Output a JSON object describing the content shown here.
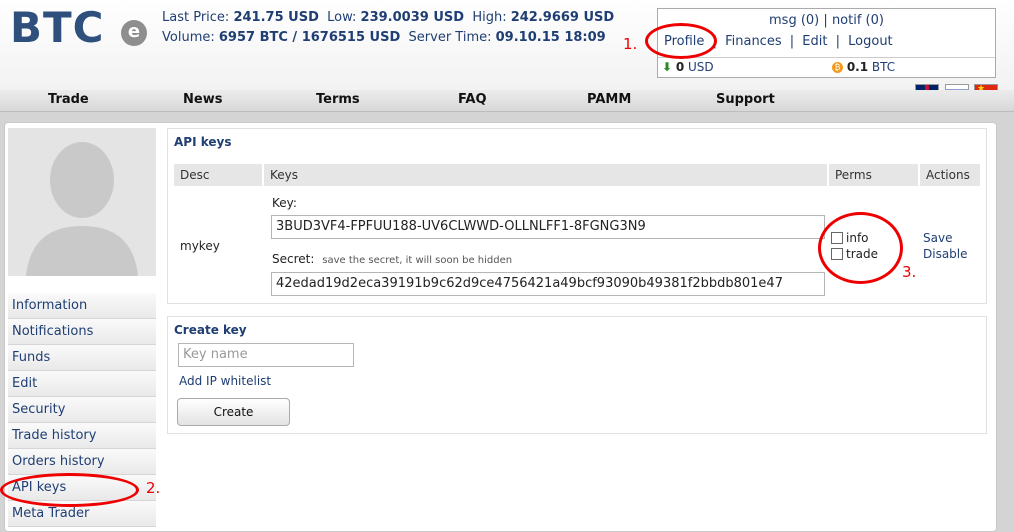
{
  "header": {
    "logo_text": "BTC",
    "logo_badge": "e",
    "last_price_label": "Last Price:",
    "last_price": "241.75 USD",
    "low_label": "Low:",
    "low": "239.0039 USD",
    "high_label": "High:",
    "high": "242.9669 USD",
    "volume_label": "Volume:",
    "volume": "6957 BTC / 1676515 USD",
    "server_time_label": "Server Time:",
    "server_time": "09.10.15 18:09"
  },
  "userbox": {
    "msg": "msg (0)",
    "notif": "notif (0)",
    "profile": "Profile",
    "finances": "Finances",
    "edit": "Edit",
    "logout": "Logout",
    "usd_amount": "0",
    "usd_unit": "USD",
    "btc_amount": "0.1",
    "btc_unit": "BTC"
  },
  "nav": [
    "Trade",
    "News",
    "Terms",
    "FAQ",
    "PAMM",
    "Support"
  ],
  "sidebar": [
    "Information",
    "Notifications",
    "Funds",
    "Edit",
    "Security",
    "Trade history",
    "Orders history",
    "API keys",
    "Meta Trader"
  ],
  "api_keys": {
    "title": "API keys",
    "headers": [
      "Desc",
      "Keys",
      "Perms",
      "Actions"
    ],
    "desc": "mykey",
    "key_label": "Key:",
    "key_value": "3BUD3VF4-FPFUU188-UV6CLWWD-OLLNLFF1-8FGNG3N9",
    "secret_label": "Secret:",
    "secret_hint": "save the secret, it will soon be hidden",
    "secret_value": "42edad19d2eca39191b9c62d9ce4756421a49bcf93090b49381f2bbdb801e47",
    "perm_info": "info",
    "perm_trade": "trade",
    "action_save": "Save",
    "action_disable": "Disable"
  },
  "create_key": {
    "title": "Create key",
    "placeholder": "Key name",
    "ip_link": "Add IP whitelist",
    "button": "Create"
  },
  "annotations": [
    "1.",
    "2.",
    "3."
  ]
}
